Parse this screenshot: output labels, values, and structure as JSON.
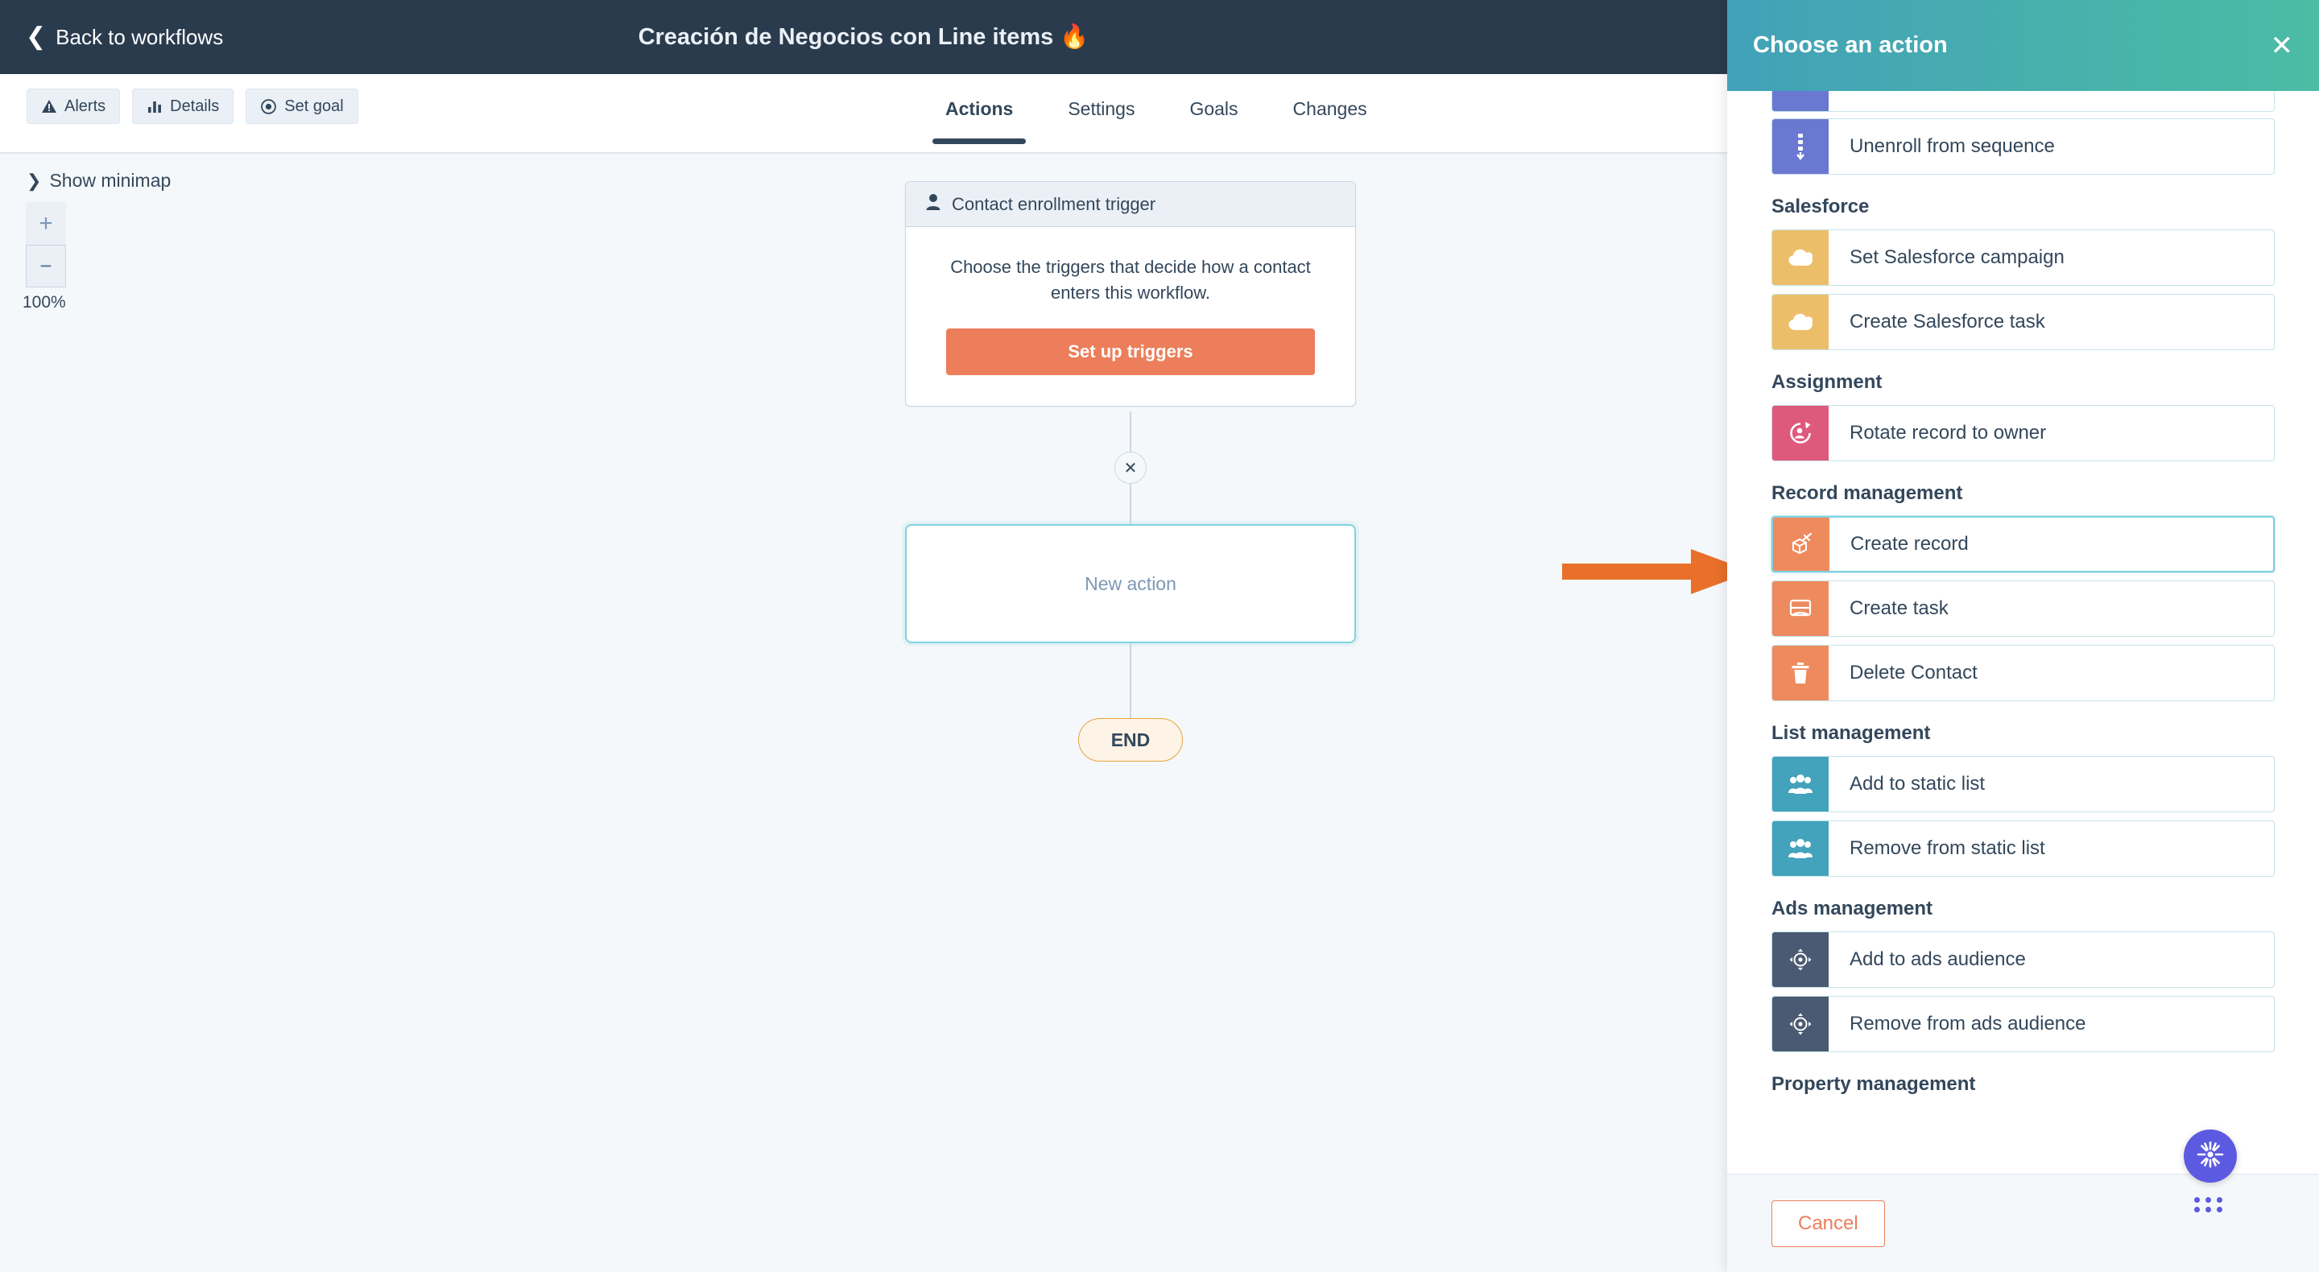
{
  "navbar": {
    "back_label": "Back to workflows",
    "title": "Creación de Negocios con Line items 🔥"
  },
  "toolbar": {
    "buttons": [
      {
        "label": "Alerts",
        "icon": "alert-triangle-icon"
      },
      {
        "label": "Details",
        "icon": "bar-chart-icon"
      },
      {
        "label": "Set goal",
        "icon": "target-icon"
      }
    ]
  },
  "tabs": [
    {
      "label": "Actions",
      "active": true
    },
    {
      "label": "Settings",
      "active": false
    },
    {
      "label": "Goals",
      "active": false
    },
    {
      "label": "Changes",
      "active": false
    }
  ],
  "canvas": {
    "minimap_label": "Show minimap",
    "zoom_in": "+",
    "zoom_out": "−",
    "zoom_percent": "100%",
    "trigger": {
      "header": "Contact enrollment trigger",
      "description": "Choose the triggers that decide how a contact enters this workflow.",
      "button": "Set up triggers"
    },
    "new_action_label": "New action",
    "end_label": "END",
    "add_node_glyph": "✕"
  },
  "annotation": {
    "arrow_color": "#E8702A"
  },
  "panel": {
    "title": "Choose an action",
    "close_glyph": "✕",
    "cancel_label": "Cancel",
    "partial_top_item": {
      "label": "",
      "icon_color": "#6A78D1"
    },
    "groups": [
      {
        "title": "",
        "items": [
          {
            "label": "Unenroll from sequence",
            "icon": "sequence-unenroll-icon",
            "color": "#6A78D1",
            "selected": false
          }
        ]
      },
      {
        "title": "Salesforce",
        "items": [
          {
            "label": "Set Salesforce campaign",
            "icon": "cloud-icon",
            "color": "#EDBE6A",
            "selected": false
          },
          {
            "label": "Create Salesforce task",
            "icon": "cloud-icon",
            "color": "#EDBE6A",
            "selected": false
          }
        ]
      },
      {
        "title": "Assignment",
        "items": [
          {
            "label": "Rotate record to owner",
            "icon": "rotate-owner-icon",
            "color": "#DE5A7C",
            "selected": false
          }
        ]
      },
      {
        "title": "Record management",
        "items": [
          {
            "label": "Create record",
            "icon": "create-record-icon",
            "color": "#ED8B5E",
            "selected": true
          },
          {
            "label": "Create task",
            "icon": "task-icon",
            "color": "#ED8B5E",
            "selected": false
          },
          {
            "label": "Delete Contact",
            "icon": "trash-icon",
            "color": "#ED8B5E",
            "selected": false
          }
        ]
      },
      {
        "title": "List management",
        "items": [
          {
            "label": "Add to static list",
            "icon": "people-icon",
            "color": "#43A2BC",
            "selected": false
          },
          {
            "label": "Remove from static list",
            "icon": "people-icon",
            "color": "#43A2BC",
            "selected": false
          }
        ]
      },
      {
        "title": "Ads management",
        "items": [
          {
            "label": "Add to ads audience",
            "icon": "ads-target-icon",
            "color": "#4A5A72",
            "selected": false
          },
          {
            "label": "Remove from ads audience",
            "icon": "ads-target-icon",
            "color": "#4A5A72",
            "selected": false
          }
        ]
      },
      {
        "title": "Property management",
        "items": []
      }
    ]
  },
  "colors": {
    "navy": "#2A3B4D",
    "canvas_bg": "#F5F8FA",
    "accent_orange": "#EC7E5B",
    "panel_gradient_start": "#42A1B8",
    "panel_gradient_end": "#4CBCA4",
    "selected_border": "#7FD1DE",
    "fab_purple": "#5C5AE0"
  }
}
